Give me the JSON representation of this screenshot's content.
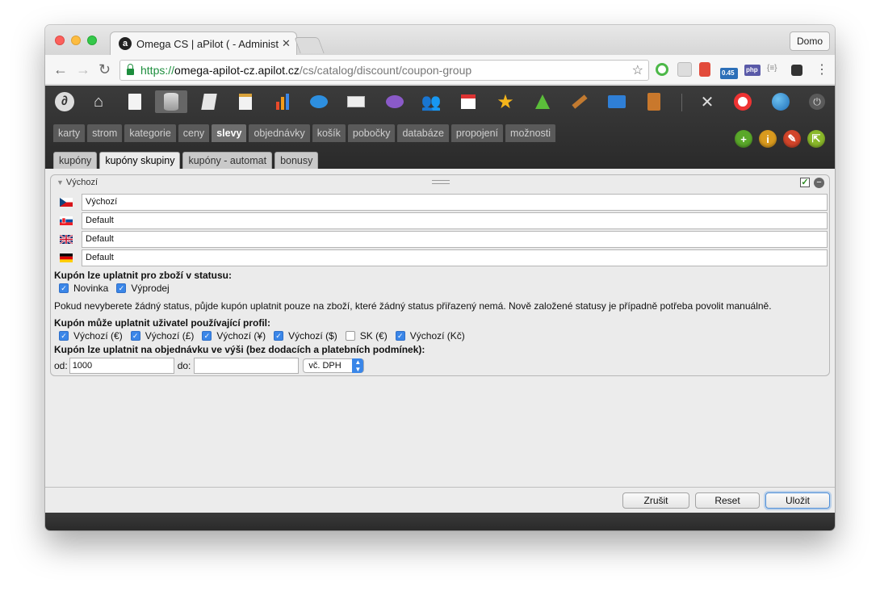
{
  "browser": {
    "tab_title": "Omega CS | aPilot ( - Administ",
    "tab_favicon": "a",
    "profile_label": "Domo",
    "url_scheme": "https://",
    "url_host": "omega-apilot-cz.apilot.cz",
    "url_path": "/cs/catalog/discount/coupon-group",
    "ext_badge": "0.45",
    "ext_php": "php",
    "ext_braces": "{≡}"
  },
  "app": {
    "main_nav": [
      "karty",
      "strom",
      "kategorie",
      "ceny",
      "slevy",
      "objednávky",
      "košík",
      "pobočky",
      "databáze",
      "propojení",
      "možnosti"
    ],
    "main_nav_active": "slevy",
    "sub_nav": [
      "kupóny",
      "kupóny skupiny",
      "kupóny - automat",
      "bonusy"
    ],
    "sub_nav_active": "kupóny skupiny"
  },
  "panel": {
    "title": "Výchozí",
    "languages": [
      {
        "flag": "cz-flag",
        "value": "Výchozí"
      },
      {
        "flag": "sk-flag",
        "value": "Default"
      },
      {
        "flag": "uk-flag",
        "value": "Default"
      },
      {
        "flag": "de-flag",
        "value": "Default"
      }
    ],
    "status_heading": "Kupón lze uplatnit pro zboží v statusu:",
    "status_options": [
      {
        "label": "Novinka",
        "checked": true
      },
      {
        "label": "Výprodej",
        "checked": true
      }
    ],
    "status_note": "Pokud nevyberete žádný status, půjde kupón uplatnit pouze na zboží, které žádný status přiřazený nemá. Nově založené statusy je případně potřeba povolit manuálně.",
    "profile_heading": "Kupón může uplatnit uživatel používající profil:",
    "profile_options": [
      {
        "label": "Výchozí (€)",
        "checked": true
      },
      {
        "label": "Výchozí (£)",
        "checked": true
      },
      {
        "label": "Výchozí (¥)",
        "checked": true
      },
      {
        "label": "Výchozí ($)",
        "checked": true
      },
      {
        "label": "SK (€)",
        "checked": false
      },
      {
        "label": "Výchozí (Kč)",
        "checked": true
      }
    ],
    "amount_heading": "Kupón lze uplatnit na objednávku ve výši (bez dodacích a platebních podmínek):",
    "from_label": "od:",
    "from_value": "1000",
    "to_label": "do:",
    "to_value": "",
    "vat_select": "vč. DPH"
  },
  "actions": {
    "cancel": "Zrušit",
    "reset": "Reset",
    "save": "Uložit"
  },
  "colors": {
    "accent_blue": "#3a86e8",
    "header_dark": "#2f2f2f",
    "url_green": "#1e8e3e"
  }
}
